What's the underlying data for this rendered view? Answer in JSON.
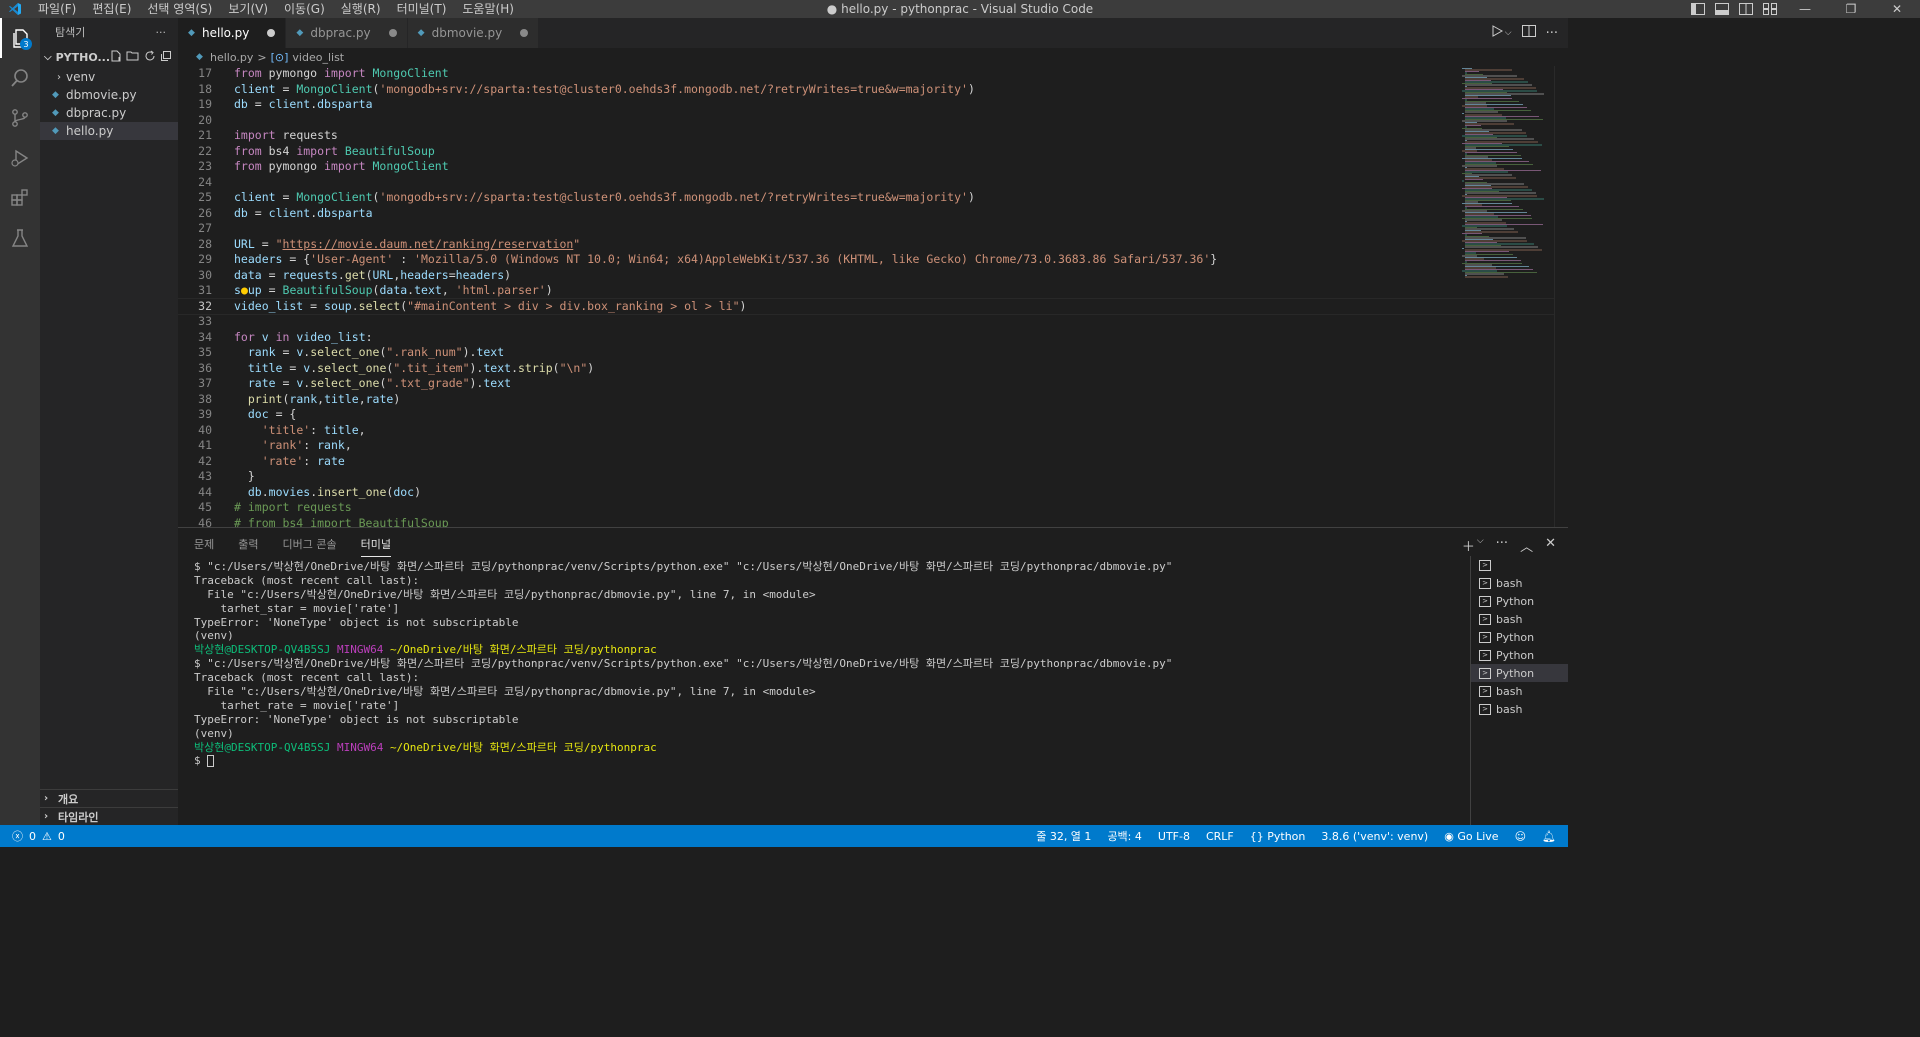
{
  "window": {
    "title": "● hello.py - pythonprac - Visual Studio Code"
  },
  "menu": [
    "파일(F)",
    "편집(E)",
    "선택 영역(S)",
    "보기(V)",
    "이동(G)",
    "실행(R)",
    "터미널(T)",
    "도움말(H)"
  ],
  "activity": {
    "explorer_badge": "3"
  },
  "sidebar": {
    "title": "탐색기",
    "more": "···",
    "folder": "PYTHO...",
    "items": [
      {
        "label": "venv",
        "type": "folder"
      },
      {
        "label": "dbmovie.py",
        "type": "file"
      },
      {
        "label": "dbprac.py",
        "type": "file"
      },
      {
        "label": "hello.py",
        "type": "file"
      }
    ],
    "outline": "개요",
    "timeline": "타임라인"
  },
  "tabs": [
    {
      "label": "hello.py",
      "active": true
    },
    {
      "label": "dbprac.py",
      "active": false
    },
    {
      "label": "dbmovie.py",
      "active": false
    }
  ],
  "breadcrumb": {
    "file": "hello.py",
    "sep": ">",
    "symbol_icon": "[⊙]",
    "symbol": "video_list"
  },
  "code_lines": [
    {
      "n": "17",
      "html": "<span class=\"kw\">from</span> pymongo <span class=\"kw\">import</span> <span class=\"cls\">MongoClient</span>"
    },
    {
      "n": "18",
      "html": "<span class=\"var\">client</span> = <span class=\"cls\">MongoClient</span>(<span class=\"str\">'mongodb+srv://sparta:test@cluster0.oehds3f.mongodb.net/?retryWrites=true&amp;w=majority'</span>)"
    },
    {
      "n": "19",
      "html": "<span class=\"var\">db</span> = <span class=\"var\">client</span>.<span class=\"var\">dbsparta</span>"
    },
    {
      "n": "20",
      "html": ""
    },
    {
      "n": "21",
      "html": "<span class=\"kw\">import</span> requests"
    },
    {
      "n": "22",
      "html": "<span class=\"kw\">from</span> bs4 <span class=\"kw\">import</span> <span class=\"cls\">BeautifulSoup</span>"
    },
    {
      "n": "23",
      "html": "<span class=\"kw\">from</span> pymongo <span class=\"kw\">import</span> <span class=\"cls\">MongoClient</span>"
    },
    {
      "n": "24",
      "html": ""
    },
    {
      "n": "25",
      "html": "<span class=\"var\">client</span> = <span class=\"cls\">MongoClient</span>(<span class=\"str\">'mongodb+srv://sparta:test@cluster0.oehds3f.mongodb.net/?retryWrites=true&amp;w=majority'</span>)"
    },
    {
      "n": "26",
      "html": "<span class=\"var\">db</span> = <span class=\"var\">client</span>.<span class=\"var\">dbsparta</span>"
    },
    {
      "n": "27",
      "html": ""
    },
    {
      "n": "28",
      "html": "<span class=\"var\">URL</span> = <span class=\"str\">\"</span><span class=\"url\">https://movie.daum.net/ranking/reservation</span><span class=\"str\">\"</span>"
    },
    {
      "n": "29",
      "html": "<span class=\"var\">headers</span> = {<span class=\"str\">'User-Agent'</span> : <span class=\"str\">'Mozilla/5.0 (Windows NT 10.0; Win64; x64)AppleWebKit/537.36 (KHTML, like Gecko) Chrome/73.0.3683.86 Safari/537.36'</span>}"
    },
    {
      "n": "30",
      "html": "<span class=\"var\">data</span> = <span class=\"var\">requests</span>.<span class=\"fn\">get</span>(<span class=\"var\">URL</span>,<span class=\"var\">headers</span>=<span class=\"var\">headers</span>)"
    },
    {
      "n": "31",
      "html": "<span class=\"var\">s</span><span class=\"bulb\">●</span><span class=\"var\">up</span> = <span class=\"cls\">BeautifulSoup</span>(<span class=\"var\">data</span>.<span class=\"var\">text</span>, <span class=\"str\">'html.parser'</span>)"
    },
    {
      "n": "32",
      "html": "<span class=\"var\">video_list</span> = <span class=\"var\">soup</span>.<span class=\"fn\">select</span>(<span class=\"str\">\"#mainContent &gt; div &gt; div.box_ranking &gt; ol &gt; li\"</span>)"
    },
    {
      "n": "33",
      "html": ""
    },
    {
      "n": "34",
      "html": "<span class=\"kw\">for</span> <span class=\"var\">v</span> <span class=\"kw\">in</span> <span class=\"var\">video_list</span>:"
    },
    {
      "n": "35",
      "html": "  <span class=\"var\">rank</span> = <span class=\"var\">v</span>.<span class=\"fn\">select_one</span>(<span class=\"str\">\".rank_num\"</span>).<span class=\"var\">text</span>"
    },
    {
      "n": "36",
      "html": "  <span class=\"var\">title</span> = <span class=\"var\">v</span>.<span class=\"fn\">select_one</span>(<span class=\"str\">\".tit_item\"</span>).<span class=\"var\">text</span>.<span class=\"fn\">strip</span>(<span class=\"str\">\"\\n\"</span>)"
    },
    {
      "n": "37",
      "html": "  <span class=\"var\">rate</span> = <span class=\"var\">v</span>.<span class=\"fn\">select_one</span>(<span class=\"str\">\".txt_grade\"</span>).<span class=\"var\">text</span>"
    },
    {
      "n": "38",
      "html": "  <span class=\"fn\">print</span>(<span class=\"var\">rank</span>,<span class=\"var\">title</span>,<span class=\"var\">rate</span>)"
    },
    {
      "n": "39",
      "html": "  <span class=\"var\">doc</span> = {"
    },
    {
      "n": "40",
      "html": "    <span class=\"str\">'title'</span>: <span class=\"var\">title</span>,"
    },
    {
      "n": "41",
      "html": "    <span class=\"str\">'rank'</span>: <span class=\"var\">rank</span>,"
    },
    {
      "n": "42",
      "html": "    <span class=\"str\">'rate'</span>: <span class=\"var\">rate</span>"
    },
    {
      "n": "43",
      "html": "  }"
    },
    {
      "n": "44",
      "html": "  <span class=\"var\">db</span>.<span class=\"var\">movies</span>.<span class=\"fn\">insert_one</span>(<span class=\"var\">doc</span>)"
    },
    {
      "n": "45",
      "html": "<span class=\"cmt\"># import requests</span>"
    },
    {
      "n": "46",
      "html": "<span class=\"cmt\"># from bs4 import BeautifulSoup</span>"
    }
  ],
  "panel": {
    "tabs": [
      "문제",
      "출력",
      "디버그 콘솔",
      "터미널"
    ],
    "active_tab": "터미널"
  },
  "terminal_lines": [
    {
      "html": "$ \"c:/Users/박상현/OneDrive/바탕 화면/스파르타 코딩/pythonprac/venv/Scripts/python.exe\" \"c:/Users/박상현/OneDrive/바탕 화면/스파르타 코딩/pythonprac/dbmovie.py\""
    },
    {
      "html": "Traceback (most recent call last):"
    },
    {
      "html": "  File \"c:/Users/박상현/OneDrive/바탕 화면/스파르타 코딩/pythonprac/dbmovie.py\", line 7, in &lt;module&gt;"
    },
    {
      "html": "    tarhet_star = movie['rate']"
    },
    {
      "html": "TypeError: 'NoneType' object is not subscriptable"
    },
    {
      "html": "(venv)"
    },
    {
      "html": "<span class=\"t-green\">박상현@DESKTOP-QV4B5SJ</span> <span class=\"t-purple\">MINGW64</span> <span class=\"t-yellow\">~/OneDrive/바탕 화면/스파르타 코딩/pythonprac</span>"
    },
    {
      "html": "$ \"c:/Users/박상현/OneDrive/바탕 화면/스파르타 코딩/pythonprac/venv/Scripts/python.exe\" \"c:/Users/박상현/OneDrive/바탕 화면/스파르타 코딩/pythonprac/dbmovie.py\""
    },
    {
      "html": "Traceback (most recent call last):"
    },
    {
      "html": "  File \"c:/Users/박상현/OneDrive/바탕 화면/스파르타 코딩/pythonprac/dbmovie.py\", line 7, in &lt;module&gt;"
    },
    {
      "html": "    tarhet_rate = movie['rate']"
    },
    {
      "html": "TypeError: 'NoneType' object is not subscriptable"
    },
    {
      "html": "(venv)"
    },
    {
      "html": "<span class=\"t-green\">박상현@DESKTOP-QV4B5SJ</span> <span class=\"t-purple\">MINGW64</span> <span class=\"t-yellow\">~/OneDrive/바탕 화면/스파르타 코딩/pythonprac</span>"
    },
    {
      "html": "$ <span class=\"cursor\"></span>"
    }
  ],
  "terminal_list": [
    {
      "label": "",
      "selected": false
    },
    {
      "label": "bash",
      "selected": false
    },
    {
      "label": "Python",
      "selected": false
    },
    {
      "label": "bash",
      "selected": false
    },
    {
      "label": "Python",
      "selected": false
    },
    {
      "label": "Python",
      "selected": false
    },
    {
      "label": "Python",
      "selected": true
    },
    {
      "label": "bash",
      "selected": false
    },
    {
      "label": "bash",
      "selected": false
    }
  ],
  "statusbar": {
    "errors": "0",
    "warnings": "0",
    "position": "줄 32, 열 1",
    "spaces": "공백: 4",
    "encoding": "UTF-8",
    "eol": "CRLF",
    "language": "Python",
    "interpreter": "3.8.6 ('venv': venv)",
    "golive": "Go Live"
  },
  "colors": {
    "statusbar": "#007acc",
    "activitybar": "#333333",
    "sidebar": "#252526",
    "editor": "#1e1e1e"
  }
}
